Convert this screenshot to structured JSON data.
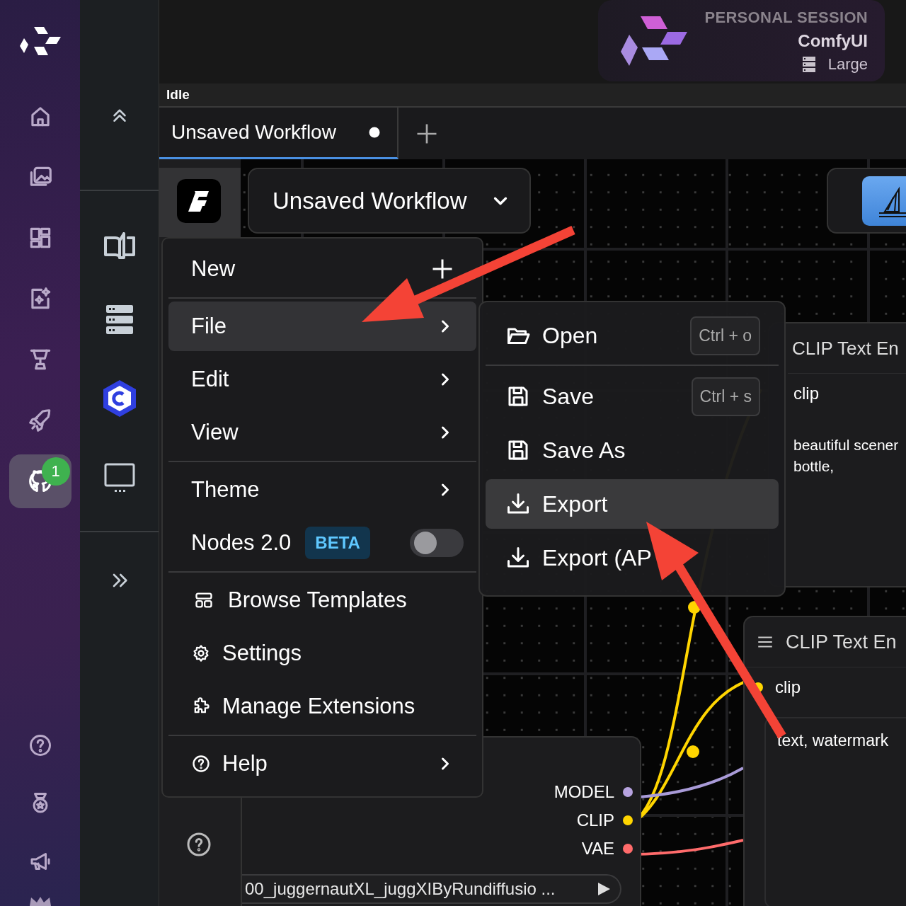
{
  "rail": {
    "items": [
      {
        "selected": false
      },
      {
        "selected": false
      },
      {
        "selected": false
      },
      {
        "selected": false
      },
      {
        "selected": false
      },
      {
        "selected": false
      },
      {
        "selected": true,
        "badge": "1"
      }
    ]
  },
  "session": {
    "label": "PERSONAL SESSION",
    "name": "ComfyUI",
    "size": "Large"
  },
  "status": "Idle",
  "tabs": [
    {
      "label": "Unsaved Workflow",
      "selected": true,
      "unsaved": true
    }
  ],
  "workflow_dropdown": {
    "value": "Unsaved Workflow"
  },
  "menu": {
    "groups": [
      [
        {
          "kind": "plus",
          "label": "New",
          "selected": false
        }
      ],
      [
        {
          "kind": "submenu",
          "label": "File",
          "selected": true
        },
        {
          "kind": "submenu",
          "label": "Edit",
          "selected": false
        },
        {
          "kind": "submenu",
          "label": "View",
          "selected": false
        }
      ],
      [
        {
          "kind": "submenu",
          "label": "Theme",
          "selected": false
        },
        {
          "kind": "toggle",
          "label": "Nodes 2.0",
          "badge": "BETA",
          "on": false,
          "selected": false
        }
      ],
      [
        {
          "kind": "icon",
          "label": "Browse Templates",
          "selected": false
        },
        {
          "kind": "icon",
          "label": "Settings",
          "selected": false
        },
        {
          "kind": "icon",
          "label": "Manage Extensions",
          "selected": false
        }
      ],
      [
        {
          "kind": "icon-submenu",
          "label": "Help",
          "selected": false
        }
      ]
    ]
  },
  "submenu": {
    "groups": [
      [
        {
          "label": "Open",
          "shortcut": "Ctrl + o",
          "selected": false
        }
      ],
      [
        {
          "label": "Save",
          "shortcut": "Ctrl + s",
          "selected": false
        },
        {
          "label": "Save As",
          "selected": false
        },
        {
          "label": "Export",
          "selected": true
        },
        {
          "label": "Export (AP",
          "selected": false
        }
      ]
    ]
  },
  "nodes": [
    {
      "kind": "text-encode",
      "title": "CLIP Text En",
      "input": "clip",
      "text_lines": [
        "beautiful scener",
        "bottle,"
      ]
    },
    {
      "kind": "text-encode",
      "title": "CLIP Text En",
      "input": "clip",
      "text_lines": [
        "text, watermark"
      ]
    },
    {
      "kind": "loader",
      "outputs": [
        {
          "name": "MODEL",
          "color": "#b7a3e0"
        },
        {
          "name": "CLIP",
          "color": "#ffd500"
        },
        {
          "name": "VAE",
          "color": "#ff6b6b"
        }
      ],
      "widget": "00_juggernautXL_juggXIByRundiffusio ..."
    }
  ]
}
